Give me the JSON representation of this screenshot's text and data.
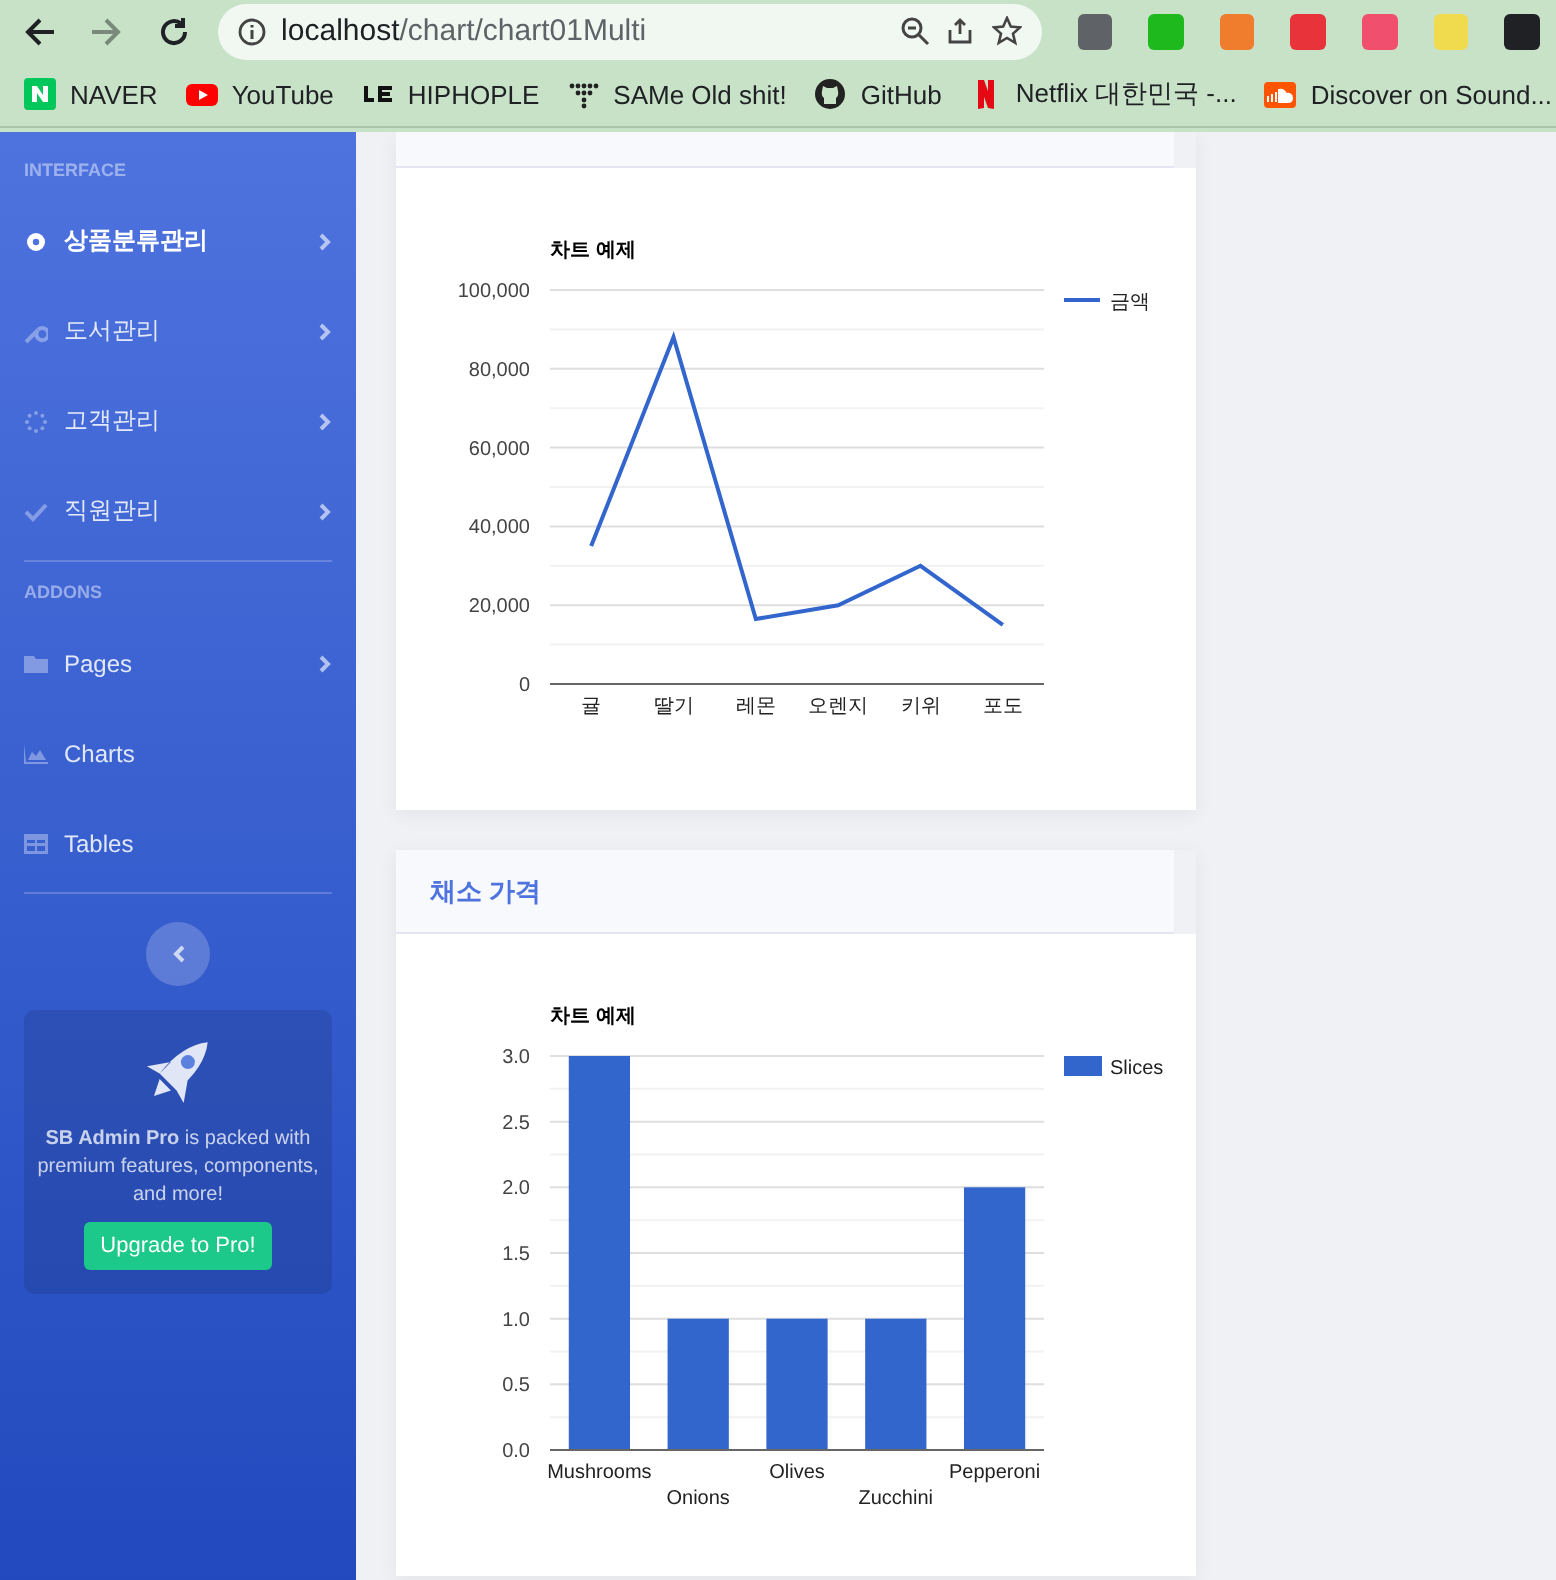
{
  "browser": {
    "url_host": "localhost",
    "url_path": "/chart/chart01Multi",
    "extensions": [
      {
        "color": "#5f6368"
      },
      {
        "color": "#1db91d"
      },
      {
        "color": "#f07c2e"
      },
      {
        "color": "#e8333a"
      },
      {
        "color": "#f0506e"
      },
      {
        "color": "#f0db4f"
      },
      {
        "color": "#202124"
      }
    ],
    "bookmarks": [
      {
        "label": "NAVER"
      },
      {
        "label": "YouTube"
      },
      {
        "label": "HIPHOPLE"
      },
      {
        "label": "SAMe Old shit!"
      },
      {
        "label": "GitHub"
      },
      {
        "label": "Netflix 대한민국 -..."
      },
      {
        "label": "Discover on Sound..."
      }
    ]
  },
  "sidebar": {
    "sections": [
      {
        "heading": "INTERFACE",
        "items": [
          {
            "label": "상품분류관리",
            "has_arrow": true,
            "selected": true
          },
          {
            "label": "도서관리",
            "has_arrow": true,
            "selected": false
          },
          {
            "label": "고객관리",
            "has_arrow": true,
            "selected": false
          },
          {
            "label": "직원관리",
            "has_arrow": true,
            "selected": false
          }
        ]
      },
      {
        "heading": "ADDONS",
        "items": [
          {
            "label": "Pages",
            "has_arrow": true,
            "selected": false
          },
          {
            "label": "Charts",
            "has_arrow": false,
            "selected": false
          },
          {
            "label": "Tables",
            "has_arrow": false,
            "selected": false
          }
        ]
      }
    ],
    "promo": {
      "text": "**SB Admin Pro** is packed with premium features, components, and more!",
      "button": "Upgrade to Pro!"
    }
  },
  "cards": [
    {
      "chart_data": {
        "type": "line",
        "grid": true,
        "title": "차트 예제",
        "categories": [
          "귤",
          "딸기",
          "레몬",
          "오렌지",
          "키위",
          "포도"
        ],
        "series": [
          {
            "name": "금액",
            "color": "#3366cc",
            "values": [
              35000,
              88000,
              16500,
              20000,
              30000,
              15000
            ]
          }
        ],
        "ylim": [
          0,
          100000
        ],
        "yticks": [
          {
            "value": 0,
            "label": "0"
          },
          {
            "value": 20000,
            "label": "20,000"
          },
          {
            "value": 40000,
            "label": "40,000"
          },
          {
            "value": 60000,
            "label": "60,000"
          },
          {
            "value": 80000,
            "label": "80,000"
          },
          {
            "value": 100000,
            "label": "100,000"
          }
        ]
      }
    },
    {
      "title": "채소 가격",
      "chart_data": {
        "type": "bar",
        "grid": true,
        "title": "차트 예제",
        "categories": [
          "Mushrooms",
          "Onions",
          "Olives",
          "Zucchini",
          "Pepperoni"
        ],
        "series": [
          {
            "name": "Slices",
            "color": "#3366cc",
            "values": [
              3,
              1,
              1,
              1,
              2
            ]
          }
        ],
        "ylim": [
          0,
          3
        ],
        "yticks": [
          {
            "value": 0,
            "label": "0.0"
          },
          {
            "value": 0.5,
            "label": "0.5"
          },
          {
            "value": 1,
            "label": "1.0"
          },
          {
            "value": 1.5,
            "label": "1.5"
          },
          {
            "value": 2,
            "label": "2.0"
          },
          {
            "value": 2.5,
            "label": "2.5"
          },
          {
            "value": 3,
            "label": "3.0"
          }
        ]
      }
    }
  ]
}
